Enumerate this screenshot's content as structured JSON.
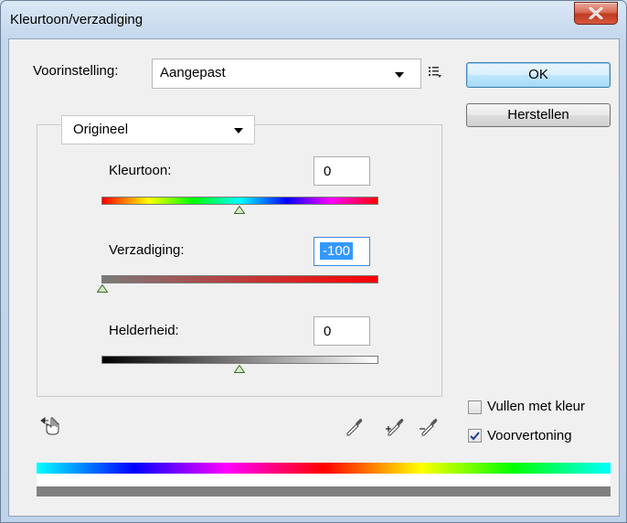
{
  "window": {
    "title": "Kleurtoon/verzadiging"
  },
  "preset": {
    "label": "Voorinstelling:",
    "value": "Aangepast"
  },
  "buttons": {
    "ok": "OK",
    "reset": "Herstellen"
  },
  "channel": {
    "value": "Origineel"
  },
  "hue": {
    "label": "Kleurtoon:",
    "value": "0",
    "slider": 0.5
  },
  "saturation": {
    "label": "Verzadiging:",
    "value": "-100",
    "slider": 0.0
  },
  "lightness": {
    "label": "Helderheid:",
    "value": "0",
    "slider": 0.5
  },
  "options": {
    "colorize": {
      "label": "Vullen met kleur",
      "checked": false
    },
    "preview": {
      "label": "Voorvertoning",
      "checked": true
    }
  },
  "icons": {
    "preset_menu": "preset-menu-icon",
    "target_adjust": "target-adjustment-hand-icon",
    "eyedropper": "eyedropper-icon",
    "eyedropper_add": "eyedropper-plus-icon",
    "eyedropper_subtract": "eyedropper-minus-icon"
  },
  "colors": {
    "selection": "#3399ff",
    "saturation_track_start": "#7a7a7a",
    "saturation_track_end": "#ff0000"
  }
}
